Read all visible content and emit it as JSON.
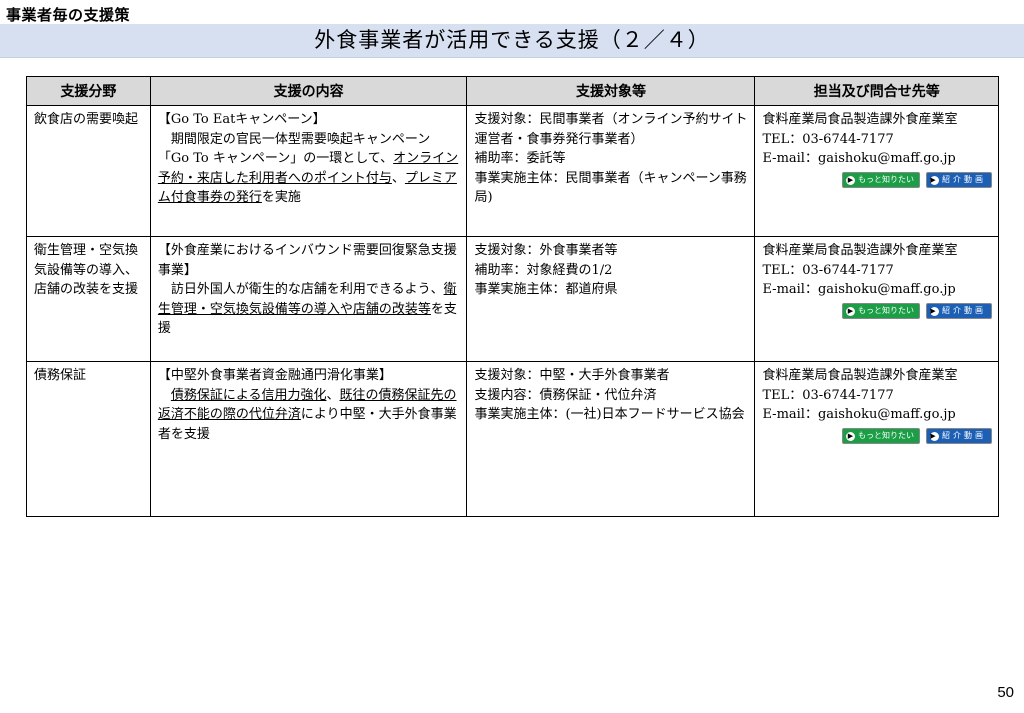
{
  "section_label": "事業者毎の支援策",
  "title": "外食事業者が活用できる支援（２／４）",
  "table": {
    "headers": [
      "支援分野",
      "支援の内容",
      "支援対象等",
      "担当及び問合せ先等"
    ],
    "rows": [
      {
        "field": "飲食店の需要喚起",
        "content_heading": "【Go To Eatキャンペーン】",
        "content_parts": [
          "期間限定の官民一体型需要喚起キャンペーン「Go To キャンペーン」の一環として、",
          "オンライン予約・来店した利用者へのポイント付与",
          "、",
          "プレミアム付食事券の発行",
          "を実施"
        ],
        "target_lines": [
          "支援対象：民間事業者（オンライン予約サイト運営者・食事券発行事業者）",
          "補助率：委託等",
          "事業実施主体：民間事業者（キャンペーン事務局)"
        ],
        "contact_lines": [
          "食料産業局食品製造課外食産業室",
          "TEL：03-6744-7177",
          "E-mail：gaishoku@maff.go.jp"
        ]
      },
      {
        "field": "衛生管理・空気換気設備等の導入、店舗の改装を支援",
        "content_heading": "【外食産業におけるインバウンド需要回復緊急支援事業】",
        "content_parts": [
          "訪日外国人が衛生的な店舗を利用できるよう、",
          "衛生管理・空気換気設備等の導入や店舗の改装等",
          "を支援"
        ],
        "target_lines": [
          "支援対象：外食事業者等",
          "補助率：対象経費の1/2",
          "事業実施主体：都道府県"
        ],
        "contact_lines": [
          "食料産業局食品製造課外食産業室",
          "TEL：03-6744-7177",
          "E-mail：gaishoku@maff.go.jp"
        ]
      },
      {
        "field": "債務保証",
        "content_heading": "【中堅外食事業者資金融通円滑化事業】",
        "content_parts": [
          "債務保証による信用力強化",
          "、",
          "既往の債務保証先の返済不能の際の代位弁済",
          "により中堅・大手外食事業者を支援"
        ],
        "target_lines": [
          "支援対象：中堅・大手外食事業者",
          "支援内容：債務保証・代位弁済",
          "事業実施主体：(一社)日本フードサービス協会"
        ],
        "contact_lines": [
          "食料産業局食品製造課外食産業室",
          "TEL：03-6744-7177",
          "E-mail：gaishoku@maff.go.jp"
        ]
      }
    ],
    "buttons": {
      "more_label": "もっと知りたい",
      "video_label": "紹介動画"
    }
  },
  "page_number": "50",
  "colors": {
    "title_bar": "#d6e0f0",
    "header_bg": "#d9d9d9",
    "more_button": "#1b9e45",
    "video_button": "#1d5fb5"
  }
}
